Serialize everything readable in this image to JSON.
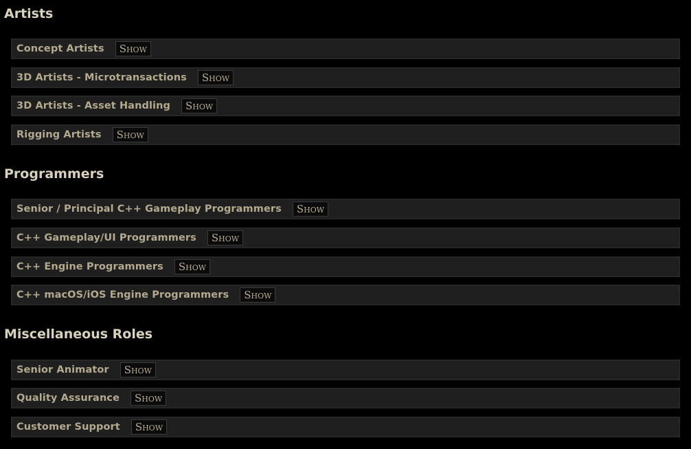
{
  "sections": [
    {
      "title": "Artists",
      "rows": [
        {
          "label": "Concept Artists",
          "button": "Show"
        },
        {
          "label": "3D Artists - Microtransactions",
          "button": "Show"
        },
        {
          "label": "3D Artists - Asset Handling",
          "button": "Show"
        },
        {
          "label": "Rigging Artists",
          "button": "Show"
        }
      ]
    },
    {
      "title": "Programmers",
      "rows": [
        {
          "label": "Senior / Principal C++ Gameplay Programmers",
          "button": "Show"
        },
        {
          "label": "C++ Gameplay/UI Programmers",
          "button": "Show"
        },
        {
          "label": "C++ Engine Programmers",
          "button": "Show"
        },
        {
          "label": "C++ macOS/iOS Engine Programmers",
          "button": "Show"
        }
      ]
    },
    {
      "title": "Miscellaneous Roles",
      "rows": [
        {
          "label": "Senior Animator",
          "button": "Show"
        },
        {
          "label": "Quality Assurance",
          "button": "Show"
        },
        {
          "label": "Customer Support",
          "button": "Show"
        }
      ]
    }
  ]
}
